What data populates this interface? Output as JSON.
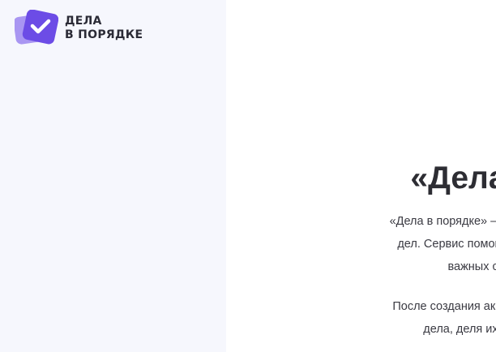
{
  "brand": {
    "line1": "ДЕЛА",
    "line2": "В ПОРЯДКЕ",
    "colors": {
      "primary": "#6c4ce6",
      "secondary": "#a996f2"
    },
    "icon": "check-icon"
  },
  "main": {
    "title": "«Дела в по",
    "paragraph1": {
      "line1": "«Дела в порядке» — это веб приложен",
      "line2": "дел. Сервис помогает пользователя",
      "line3": "важных событиях"
    },
    "paragraph2": {
      "line1": "После создания аккаунта, пользовате",
      "line2": "дела, деля их по проектам"
    }
  },
  "colors": {
    "sidebar_bg": "#f6f7fd",
    "text_dark": "#2d2d33",
    "text_body": "#3a3a42"
  }
}
